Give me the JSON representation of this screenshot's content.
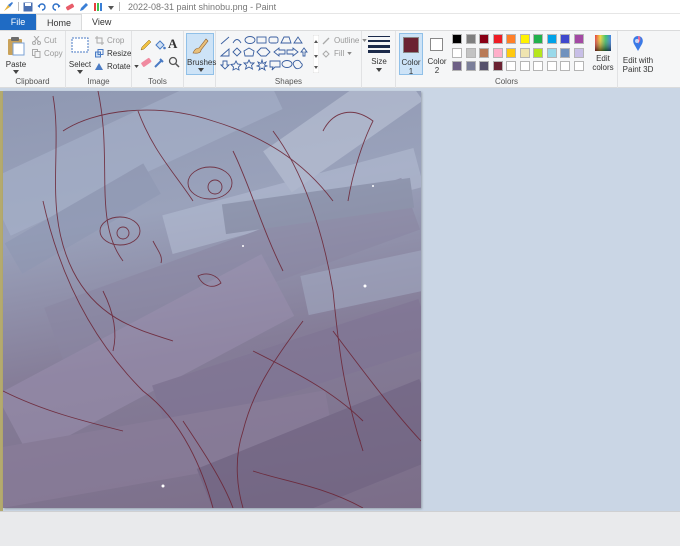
{
  "window": {
    "title": "2022-08-31 paint shinobu.png - Paint"
  },
  "tabs": {
    "file": "File",
    "home": "Home",
    "view": "View"
  },
  "clipboard": {
    "paste": "Paste",
    "cut": "Cut",
    "copy": "Copy",
    "label": "Clipboard"
  },
  "image": {
    "select": "Select",
    "crop": "Crop",
    "resize": "Resize",
    "rotate": "Rotate",
    "label": "Image"
  },
  "tools": {
    "label": "Tools"
  },
  "brushes": {
    "label": "Brushes"
  },
  "shapes": {
    "outline": "Outline",
    "fill": "Fill",
    "label": "Shapes"
  },
  "size": {
    "label": "Size"
  },
  "colors": {
    "color1": "Color 1",
    "color2": "Color 2",
    "edit": "Edit colors",
    "paint3d": "Edit with Paint 3D",
    "label": "Colors",
    "color1_value": "#6b2232",
    "color2_value": "#ffffff",
    "row1": [
      "#000000",
      "#7f7f7f",
      "#880015",
      "#ed1c24",
      "#ff7f27",
      "#fff200",
      "#22b14c",
      "#00a2e8",
      "#3f48cc",
      "#a349a4"
    ],
    "row2": [
      "#ffffff",
      "#c3c3c3",
      "#b97a57",
      "#ffaec9",
      "#ffc90e",
      "#efe4b0",
      "#b5e61d",
      "#99d9ea",
      "#7092be",
      "#c8bfe7"
    ],
    "row3": [
      "#6d5f85",
      "#7b7f99",
      "#55506b",
      "#6b2232",
      "#ffffff",
      "#ffffff",
      "#ffffff",
      "#ffffff",
      "#ffffff",
      "#ffffff"
    ]
  }
}
